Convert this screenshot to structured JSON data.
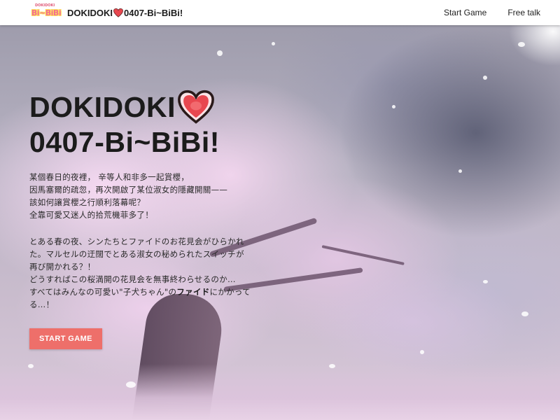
{
  "header": {
    "logo_text": "Bi~BiBi",
    "logo_top": "DOKIDOKI",
    "brand_before": "DOKIDOKI",
    "brand_after": "0407-Bi~BiBi!",
    "nav": [
      {
        "label": "Start Game"
      },
      {
        "label": "Free talk"
      }
    ]
  },
  "hero": {
    "title_line1": "DOKIDOKI",
    "title_line2": "0407-Bi~BiBi!",
    "desc_zh": [
      "某個春日的夜裡， 辛等人和非多一起賞櫻，",
      "因馬塞爾的疏忽，再次開啟了某位淑女的隱藏開關——",
      "該如何讓賞櫻之行順利落幕呢？",
      "全靠可愛又迷人的拾荒機菲多了！"
    ],
    "desc_ja": {
      "line1": "とある春の夜、シンたちとファイドのお花見会がひらかれ",
      "line2": "た。マルセルの迂闊でとある淑女の秘められたスイッチが",
      "line3": "再び開かれる？！",
      "line4": "どうすればこの桜満開の花見会を無事終わらせるのか…",
      "line5_pre": "すべてはみんなの可愛い\"子犬ちゃん\"の",
      "line5_bold": "ファイド",
      "line5_post": "にかかって",
      "line6": "る…！"
    },
    "button_label": "START GAME"
  },
  "colors": {
    "button_bg": "#ee6f6a",
    "heart": "#e8474f",
    "logo_pink": "#f36f8e",
    "logo_yellow": "#ffe45a"
  },
  "icons": {
    "brand_heart": "heart-icon",
    "title_heart": "heart-icon"
  }
}
